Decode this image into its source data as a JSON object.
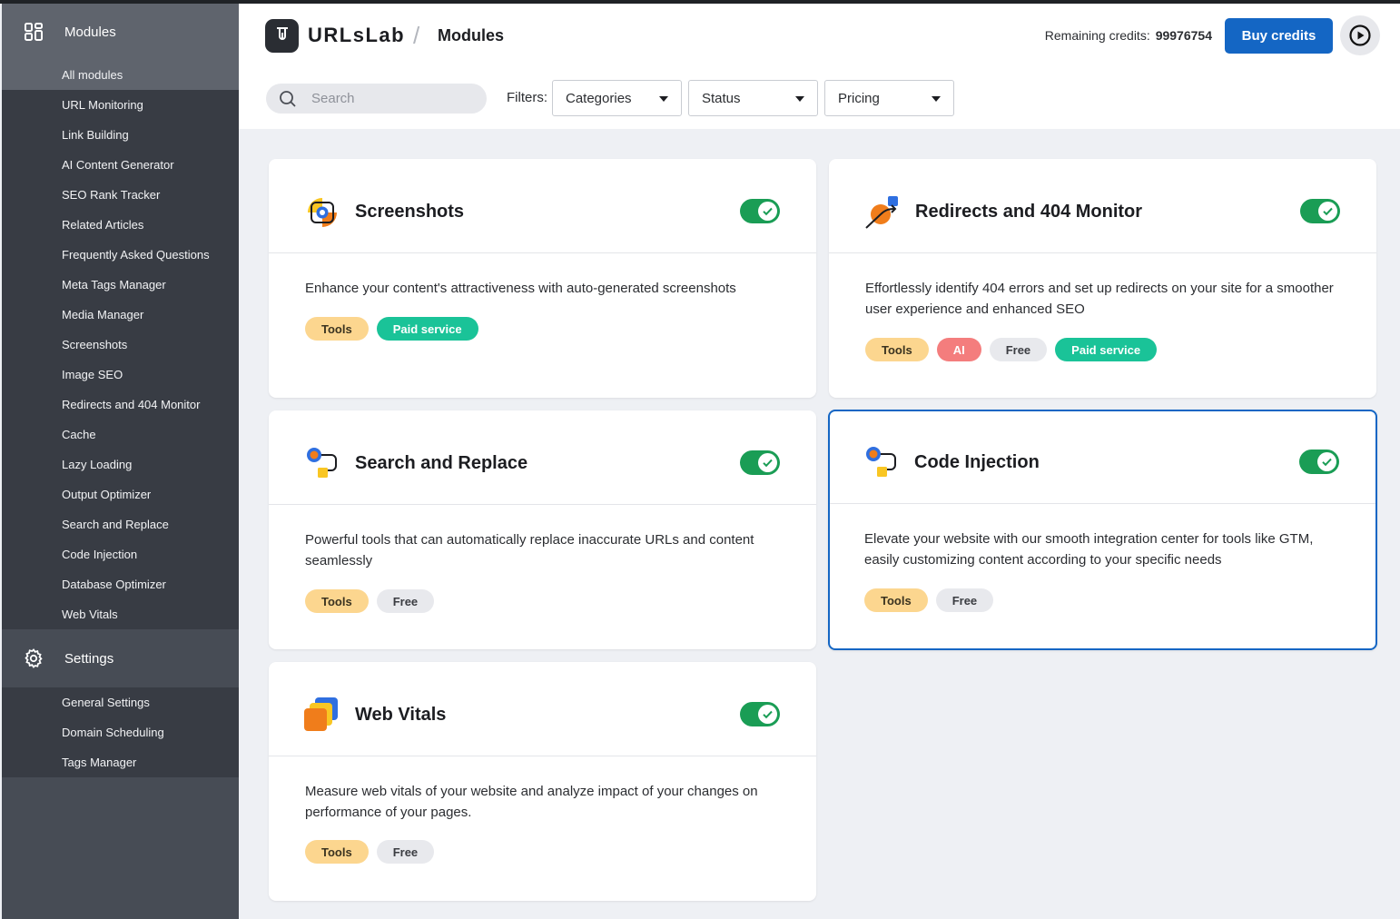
{
  "sidebar": {
    "modules_label": "Modules",
    "modules_items": [
      "All modules",
      "URL Monitoring",
      "Link Building",
      "AI Content Generator",
      "SEO Rank Tracker",
      "Related Articles",
      "Frequently Asked Questions",
      "Meta Tags Manager",
      "Media Manager",
      "Screenshots",
      "Image SEO",
      "Redirects and 404 Monitor",
      "Cache",
      "Lazy Loading",
      "Output Optimizer",
      "Search and Replace",
      "Code Injection",
      "Database Optimizer",
      "Web Vitals"
    ],
    "settings_label": "Settings",
    "settings_items": [
      "General Settings",
      "Domain Scheduling",
      "Tags Manager"
    ]
  },
  "header": {
    "brand": "URLsLab",
    "separator": "/",
    "page_title": "Modules",
    "credits_label": "Remaining credits:",
    "credits_value": "99976754",
    "buy_label": "Buy credits"
  },
  "filters": {
    "search_placeholder": "Search",
    "label": "Filters:",
    "categories": "Categories",
    "status": "Status",
    "pricing": "Pricing"
  },
  "cards": [
    {
      "title": "Screenshots",
      "description": "Enhance your content's attractiveness with auto-generated screenshots",
      "tags": [
        "Tools",
        "Paid service"
      ],
      "enabled": true
    },
    {
      "title": "Redirects and 404 Monitor",
      "description": "Effortlessly identify 404 errors and set up redirects on your site for a smoother user experience and enhanced SEO",
      "tags": [
        "Tools",
        "AI",
        "Free",
        "Paid service"
      ],
      "enabled": true
    },
    {
      "title": "Search and Replace",
      "description": "Powerful tools that can automatically replace inaccurate URLs and content seamlessly",
      "tags": [
        "Tools",
        "Free"
      ],
      "enabled": true
    },
    {
      "title": "Code Injection",
      "description": "Elevate your website with our smooth integration center for tools like GTM, easily customizing content according to your specific needs",
      "tags": [
        "Tools",
        "Free"
      ],
      "enabled": true
    },
    {
      "title": "Web Vitals",
      "description": "Measure web vitals of your website and analyze impact of your changes on performance of your pages.",
      "tags": [
        "Tools",
        "Free"
      ],
      "enabled": true
    }
  ],
  "colors": {
    "accent": "#1466c4",
    "toggle_on": "#1a9d55",
    "tag_tools": "#fcd68f",
    "tag_paid": "#1ac398",
    "tag_free": "#e8e9ed",
    "tag_ai": "#f47d7d"
  }
}
